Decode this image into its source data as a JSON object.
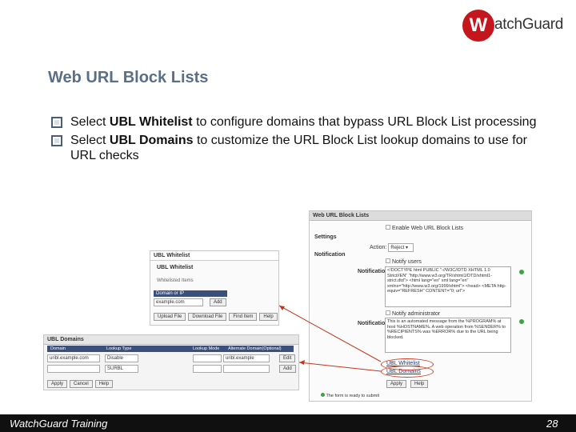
{
  "logo": {
    "mark": "W",
    "text": "atchGuard"
  },
  "slide": {
    "title": "Web URL Block Lists",
    "bullets": [
      {
        "pre": "Select ",
        "bold": "UBL Whitelist",
        "post": " to configure domains that bypass URL Block List processing"
      },
      {
        "pre": "Select ",
        "bold": "UBL Domains",
        "post": " to customize the URL Block List lookup domains to use for URL checks"
      }
    ]
  },
  "main_panel": {
    "title": "Web URL Block Lists",
    "enable_label": "Enable Web URL Block Lists",
    "settings_heading": "Settings",
    "action_label": "Action:",
    "action_value": "Reject",
    "notification_heading": "Notification",
    "notify_users_label": "Notify users",
    "notification_label": "Notification:",
    "notification_text_1": "<!DOCTYPE html PUBLIC \"-//W3C//DTD XHTML 1.0 Strict//EN\" \"http://www.w3.org/TR/xhtml1/DTD/xhtml1-strict.dtd\"> <html lang=\"en\" xml:lang=\"en\" xmlns=\"http://www.w3.org/1999/xhtml\"> <head> <META http-equiv=\"REFRESH\" CONTENT=\"0; url\">",
    "notify_admin_label": "Notify administrator",
    "notification_text_2": "This is an automated message from the %PROGRAM% at host %HOSTNAME%. A web operation from %SENDER% to %RECIPIENTS% was %ERROR% due to the URL being blocked.",
    "link_whitelist": "UBL Whitelist",
    "link_domains": "UBL Domains",
    "apply_button": "Apply",
    "help_button": "Help",
    "required_note": "The form is ready to submit"
  },
  "whitelist_panel": {
    "header": "UBL Whitelist",
    "subheader": "UBL Whitelist",
    "column_label": "Whitelisted Items",
    "field_label": "Domain or IP",
    "input_value": "example.com",
    "add_button": "Add",
    "buttons": [
      "Upload File",
      "Download File",
      "Find Item",
      "Help"
    ]
  },
  "domains_panel": {
    "header": "UBL Domains",
    "columns": [
      "Domain",
      "Lookup Type",
      "Lookup Mode",
      "Alternate Domain(Optional)"
    ],
    "row1": {
      "domain": "uribl.example.com",
      "type": "Disable",
      "mode": "uribl.example",
      "edit": "Edit"
    },
    "row2": {
      "domain": "",
      "type": "SURBL",
      "mode": "",
      "add": "Add"
    },
    "buttons": [
      "Apply",
      "Cancel",
      "Help"
    ]
  },
  "footer": {
    "left": "WatchGuard Training",
    "page": "28"
  }
}
